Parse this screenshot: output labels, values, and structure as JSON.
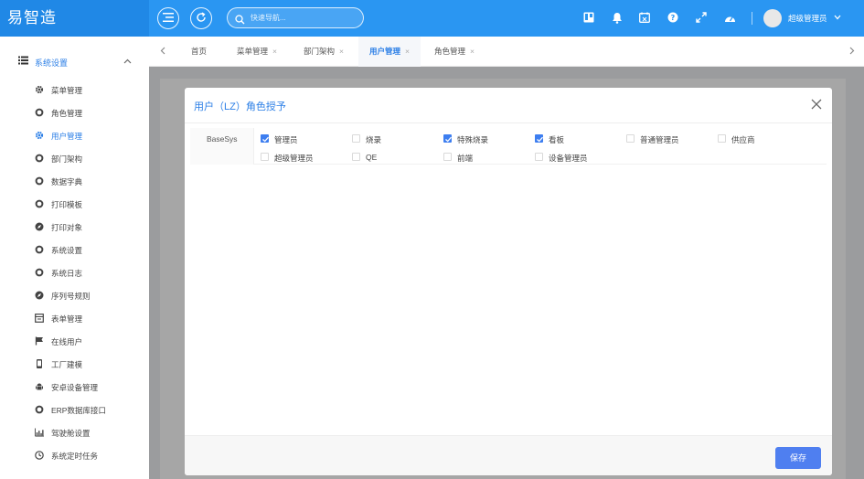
{
  "app": {
    "logo": "易智造"
  },
  "header": {
    "search_placeholder": "快速导航...",
    "username": "超级管理员"
  },
  "sidebar": {
    "group_label": "系统设置",
    "items": [
      {
        "label": "菜单管理",
        "icon": "gear-icon"
      },
      {
        "label": "角色管理",
        "icon": "circle-icon"
      },
      {
        "label": "用户管理",
        "icon": "gear-icon",
        "active": true
      },
      {
        "label": "部门架构",
        "icon": "circle-icon"
      },
      {
        "label": "数据字典",
        "icon": "circle-icon"
      },
      {
        "label": "打印模板",
        "icon": "circle-icon"
      },
      {
        "label": "打印对象",
        "icon": "compass-icon"
      },
      {
        "label": "系统设置",
        "icon": "circle-icon"
      },
      {
        "label": "系统日志",
        "icon": "circle-icon"
      },
      {
        "label": "序列号规则",
        "icon": "compass-icon"
      },
      {
        "label": "表单管理",
        "icon": "form-icon"
      },
      {
        "label": "在线用户",
        "icon": "flag-icon"
      },
      {
        "label": "工厂建模",
        "icon": "mobile-icon"
      },
      {
        "label": "安卓设备管理",
        "icon": "android-icon"
      },
      {
        "label": "ERP数据库接口",
        "icon": "circle-icon"
      },
      {
        "label": "驾驶舱设置",
        "icon": "bar-chart-icon"
      },
      {
        "label": "系统定时任务",
        "icon": "clock-icon"
      }
    ]
  },
  "tabs": [
    {
      "label": "首页",
      "closable": false
    },
    {
      "label": "菜单管理",
      "closable": true
    },
    {
      "label": "部门架构",
      "closable": true
    },
    {
      "label": "用户管理",
      "closable": true,
      "active": true
    },
    {
      "label": "角色管理",
      "closable": true
    }
  ],
  "modal": {
    "title": "用户（LZ）角色授予",
    "group": "BaseSys",
    "roles": [
      {
        "label": "管理员",
        "checked": true
      },
      {
        "label": "烧录",
        "checked": false
      },
      {
        "label": "特殊烧录",
        "checked": true
      },
      {
        "label": "看板",
        "checked": true
      },
      {
        "label": "普通管理员",
        "checked": false
      },
      {
        "label": "供应商",
        "checked": false
      },
      {
        "label": "超级管理员",
        "checked": false
      },
      {
        "label": "QE",
        "checked": false
      },
      {
        "label": "前端",
        "checked": false
      },
      {
        "label": "设备管理员",
        "checked": false
      }
    ],
    "save_label": "保存"
  },
  "colors": {
    "primary": "#2a96f2",
    "accent": "#2a7ee6",
    "checkbox": "#3d7ef0",
    "save": "#4f7ff0"
  }
}
